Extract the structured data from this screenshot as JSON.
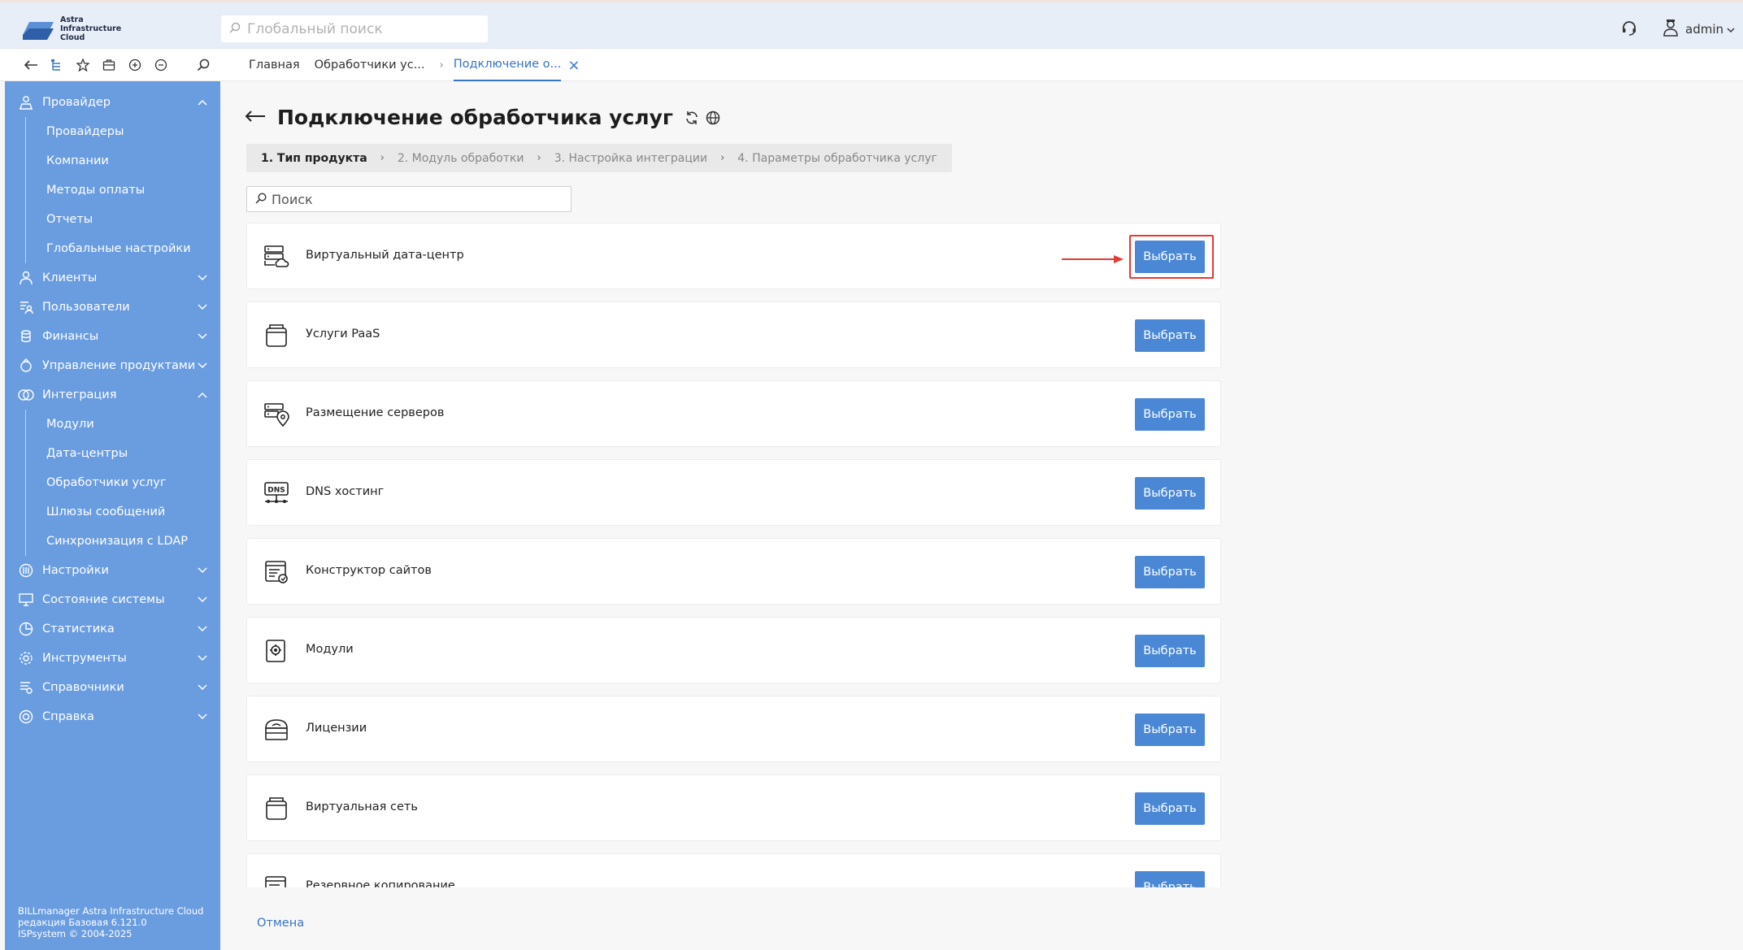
{
  "app": {
    "logo_lines": [
      "Astra",
      "Infrastructure",
      "Cloud"
    ],
    "colors": {
      "accent": "#3874c4",
      "sidebar": "#6a9ce0",
      "button": "#4a88d6",
      "highlight": "#e53935"
    }
  },
  "header": {
    "search_placeholder": "Глобальный поиск",
    "user_name": "admin"
  },
  "toolbar": {
    "icons": [
      "back-icon",
      "tree-icon",
      "star-icon",
      "briefcase-icon",
      "zoom-in-icon",
      "zoom-out-icon",
      "search-icon"
    ]
  },
  "tabs": [
    {
      "label": "Главная"
    },
    {
      "label": "Обработчики ус..."
    },
    {
      "label": "Подключение о...",
      "active": true
    }
  ],
  "sidebar": {
    "groups": [
      {
        "label": "Провайдер",
        "icon": "provider-icon",
        "expanded": true,
        "items": [
          "Провайдеры",
          "Компании",
          "Методы оплаты",
          "Отчеты",
          "Глобальные настройки"
        ]
      },
      {
        "label": "Клиенты",
        "icon": "clients-icon",
        "expanded": false
      },
      {
        "label": "Пользователи",
        "icon": "users-icon",
        "expanded": false
      },
      {
        "label": "Финансы",
        "icon": "finance-icon",
        "expanded": false
      },
      {
        "label": "Управление продуктами",
        "icon": "products-icon",
        "expanded": false
      },
      {
        "label": "Интеграция",
        "icon": "integration-icon",
        "expanded": true,
        "items": [
          "Модули",
          "Дата-центры",
          "Обработчики услуг",
          "Шлюзы сообщений",
          "Синхронизация с LDAP"
        ]
      },
      {
        "label": "Настройки",
        "icon": "settings-icon",
        "expanded": false
      },
      {
        "label": "Состояние системы",
        "icon": "monitor-icon",
        "expanded": false
      },
      {
        "label": "Статистика",
        "icon": "statistics-icon",
        "expanded": false
      },
      {
        "label": "Инструменты",
        "icon": "tools-icon",
        "expanded": false
      },
      {
        "label": "Справочники",
        "icon": "reference-icon",
        "expanded": false
      },
      {
        "label": "Справка",
        "icon": "help-icon",
        "expanded": false
      }
    ],
    "footer": [
      "BILLmanager Astra Infrastructure Cloud",
      "редакция Базовая 6.121.0",
      "ISPsystem © 2004-2025"
    ]
  },
  "page": {
    "title": "Подключение обработчика услуг",
    "steps": [
      {
        "label": "1. Тип продукта",
        "active": true
      },
      {
        "label": "2. Модуль обработки"
      },
      {
        "label": "3. Настройка интеграции"
      },
      {
        "label": "4. Параметры обработчика услуг"
      }
    ],
    "search_placeholder": "Поиск",
    "select_label": "Выбрать",
    "products": [
      {
        "label": "Виртуальный дата-центр",
        "icon": "datacenter-icon",
        "highlighted": true
      },
      {
        "label": "Услуги PaaS",
        "icon": "paas-icon"
      },
      {
        "label": "Размещение серверов",
        "icon": "server-location-icon"
      },
      {
        "label": "DNS хостинг",
        "icon": "dns-icon"
      },
      {
        "label": "Конструктор сайтов",
        "icon": "site-builder-icon"
      },
      {
        "label": "Модули",
        "icon": "module-icon"
      },
      {
        "label": "Лицензии",
        "icon": "license-icon"
      },
      {
        "label": "Виртуальная сеть",
        "icon": "virtual-network-icon"
      },
      {
        "label": "Резервное копирование",
        "icon": "backup-icon"
      }
    ],
    "cancel_label": "Отмена"
  }
}
